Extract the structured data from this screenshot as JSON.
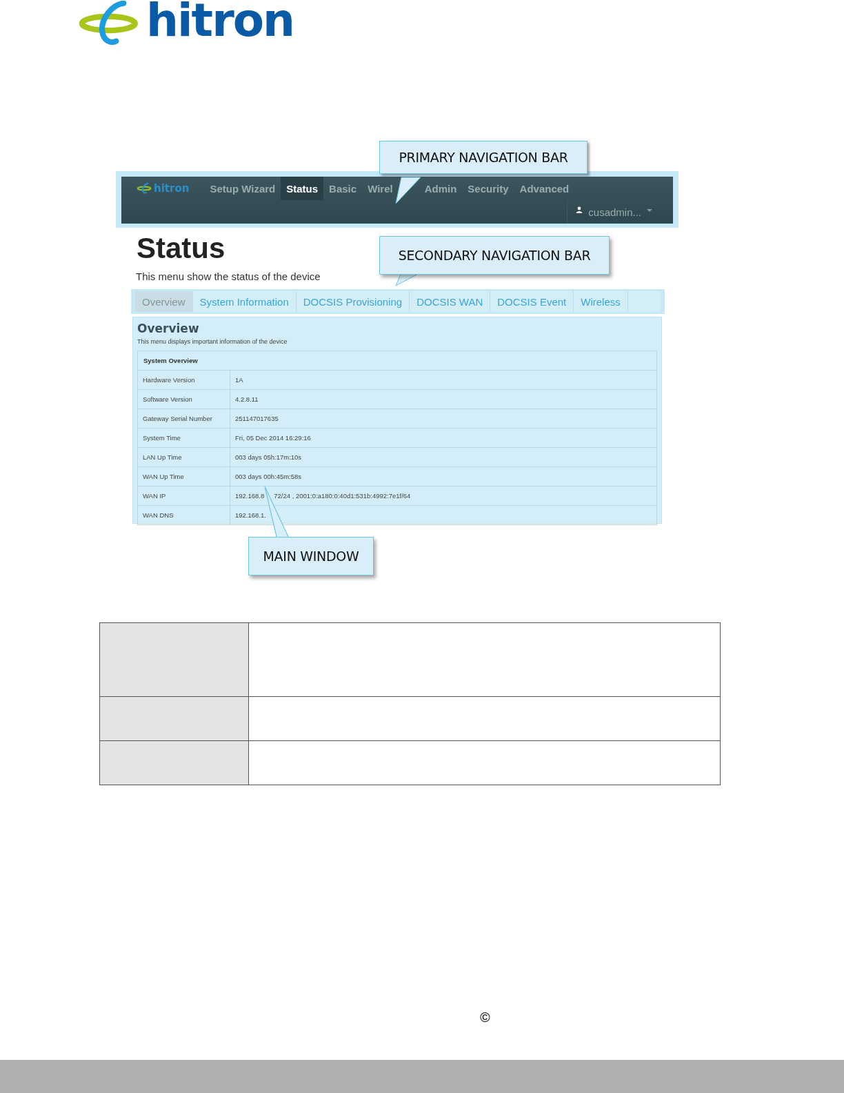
{
  "logo": {
    "text": "hitron"
  },
  "screenshot": {
    "brand": "hitron",
    "primary_nav": [
      {
        "label": "Setup Wizard",
        "selected": false
      },
      {
        "label": "Status",
        "selected": true
      },
      {
        "label": "Basic",
        "selected": false
      },
      {
        "label": "Wirel",
        "selected": false
      },
      {
        "label": "Admin",
        "selected": false
      },
      {
        "label": "Security",
        "selected": false
      },
      {
        "label": "Advanced",
        "selected": false
      }
    ],
    "user": "cusadmin...",
    "title": "Status",
    "subtitle": "This menu show the status of the device",
    "secondary_nav": [
      {
        "label": "Overview",
        "selected": true
      },
      {
        "label": "System Information",
        "selected": false
      },
      {
        "label": "DOCSIS Provisioning",
        "selected": false
      },
      {
        "label": "DOCSIS WAN",
        "selected": false
      },
      {
        "label": "DOCSIS Event",
        "selected": false
      },
      {
        "label": "Wireless",
        "selected": false
      }
    ],
    "section": {
      "title": "Overview",
      "subtitle": "This menu displays important information of the device",
      "table_title": "System Overview",
      "rows": [
        {
          "label": "Hardware Version",
          "values": [
            "1A"
          ]
        },
        {
          "label": "Software Version",
          "values": [
            "4.2.8.11"
          ]
        },
        {
          "label": "Gateway Serial Number",
          "values": [
            "251147017635"
          ]
        },
        {
          "label": "System Time",
          "values": [
            "Fri, 05 Dec 2014 16:29:16"
          ]
        },
        {
          "label": "LAN Up Time",
          "values": [
            "003 days 05h:17m:10s"
          ]
        },
        {
          "label": "WAN Up Time",
          "values": [
            "003 days 00h:45m:58s"
          ]
        },
        {
          "label": "WAN IP",
          "values": [
            "192.168.8",
            "72/24 , 2001:0:a180:0:40d1:531b:4992:7e1f/64"
          ]
        },
        {
          "label": "WAN DNS",
          "values": [
            "192.168.1."
          ]
        }
      ]
    }
  },
  "callouts": [
    {
      "text": "PRIMARY NAVIGATION BAR"
    },
    {
      "text": "SECONDARY NAVIGATION BAR"
    },
    {
      "text": "MAIN WINDOW"
    }
  ],
  "footer": {
    "copyright": "©"
  }
}
